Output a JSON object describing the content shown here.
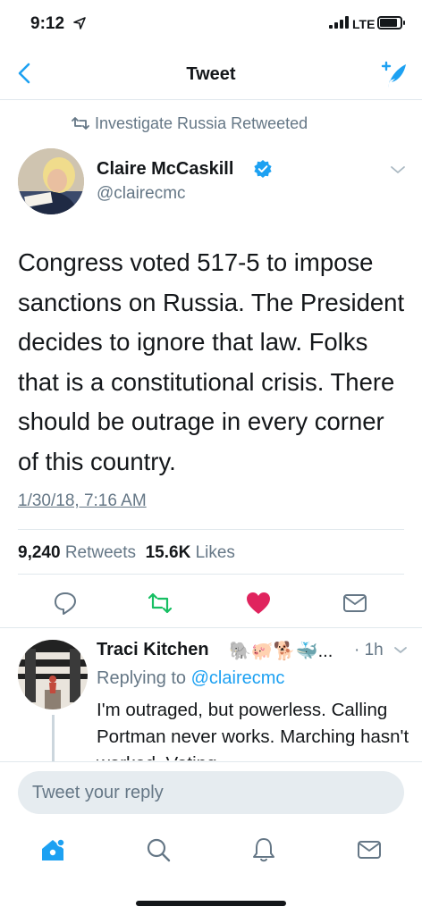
{
  "status_bar": {
    "time": "9:12",
    "network": "LTE"
  },
  "nav": {
    "title": "Tweet"
  },
  "retweet_banner": {
    "text": "Investigate Russia Retweeted"
  },
  "tweet": {
    "author_name": "Claire McCaskill",
    "author_handle": "@clairecmc",
    "text": "Congress voted 517-5 to impose sanctions on Russia. The President decides to ignore that law. Folks that is a constitutional crisis. There should be outrage in every corner of this country.",
    "timestamp": "1/30/18, 7:16 AM",
    "retweet_count": "9,240",
    "retweet_label": "Retweets",
    "like_count": "15.6K",
    "like_label": "Likes"
  },
  "reply": {
    "author_name": "Traci Kitchen",
    "emoji": "🐘🐖🐕🐳...",
    "time": "· 1h",
    "replying_prefix": "Replying to",
    "replying_to": "@clairecmc",
    "text": "I'm outraged, but powerless. Calling Portman never works. Marching hasn't worked. Voting"
  },
  "reply_box": {
    "placeholder": "Tweet your reply"
  },
  "colors": {
    "accent": "#1da1f2",
    "retweet_green": "#17bf63",
    "like_red": "#e0245e",
    "secondary_text": "#657786"
  },
  "icons": [
    "back-icon",
    "compose-tweet-icon",
    "retweet-icon",
    "verified-icon",
    "chevron-down-icon",
    "reply-icon",
    "like-icon",
    "share-icon",
    "home-icon",
    "search-icon",
    "notifications-icon",
    "messages-icon"
  ]
}
